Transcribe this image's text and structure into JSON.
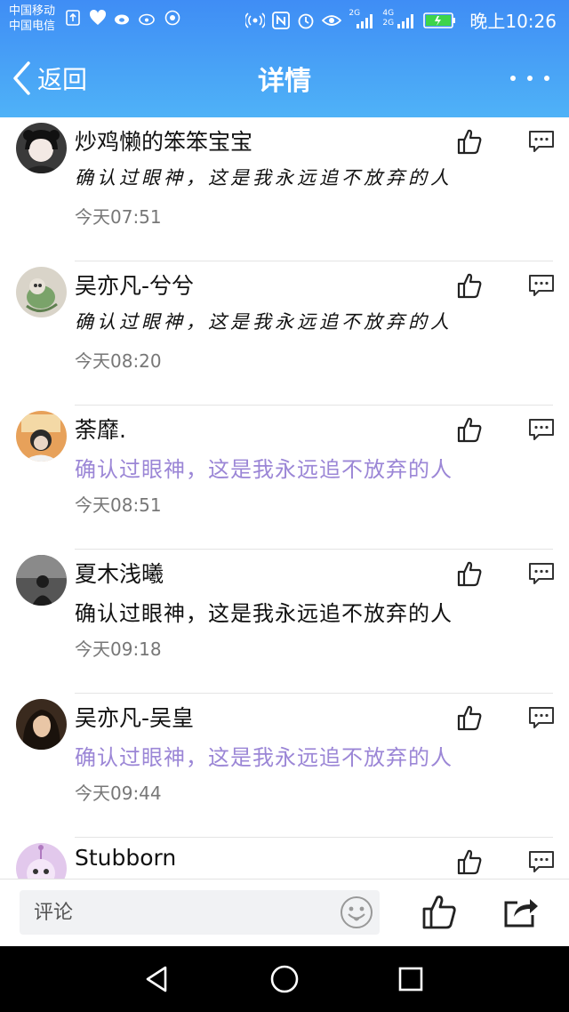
{
  "status_bar": {
    "carrier_1": "中国移动",
    "carrier_2": "中国电信",
    "net_a": "2G",
    "net_b": "4G",
    "net_c": "2G",
    "time": "晚上10:26"
  },
  "nav": {
    "back_label": "返回",
    "title": "详情"
  },
  "comments": [
    {
      "name": "炒鸡懒的笨笨宝宝",
      "text": "确认过眼神，这是我永远追不放弃的人",
      "time": "今天07:51",
      "style": "handwritten"
    },
    {
      "name": "吴亦凡-兮兮",
      "text": "确认过眼神，这是我永远追不放弃的人",
      "time": "今天08:20",
      "style": "handwritten"
    },
    {
      "name": "荼靡.",
      "text": "确认过眼神，这是我永远追不放弃的人",
      "time": "今天08:51",
      "style": "purple"
    },
    {
      "name": "夏木浅曦",
      "text": "确认过眼神，这是我永远追不放弃的人",
      "time": "今天09:18",
      "style": "normal"
    },
    {
      "name": "吴亦凡-吴皇",
      "text": "确认过眼神，这是我永远追不放弃的人",
      "time": "今天09:44",
      "style": "purple"
    },
    {
      "name": "Stubborn",
      "text": "",
      "time": "",
      "style": "normal"
    }
  ],
  "bottom_bar": {
    "comment_placeholder": "评论"
  },
  "colors": {
    "header_top": "#3f8df5",
    "header_bottom": "#4fb2f7",
    "purple_text": "#9b86d6"
  },
  "icons": {
    "like": "thumbs-up-icon",
    "comment": "comment-bubble-icon",
    "share": "share-icon",
    "emoji": "emoji-face-icon"
  }
}
